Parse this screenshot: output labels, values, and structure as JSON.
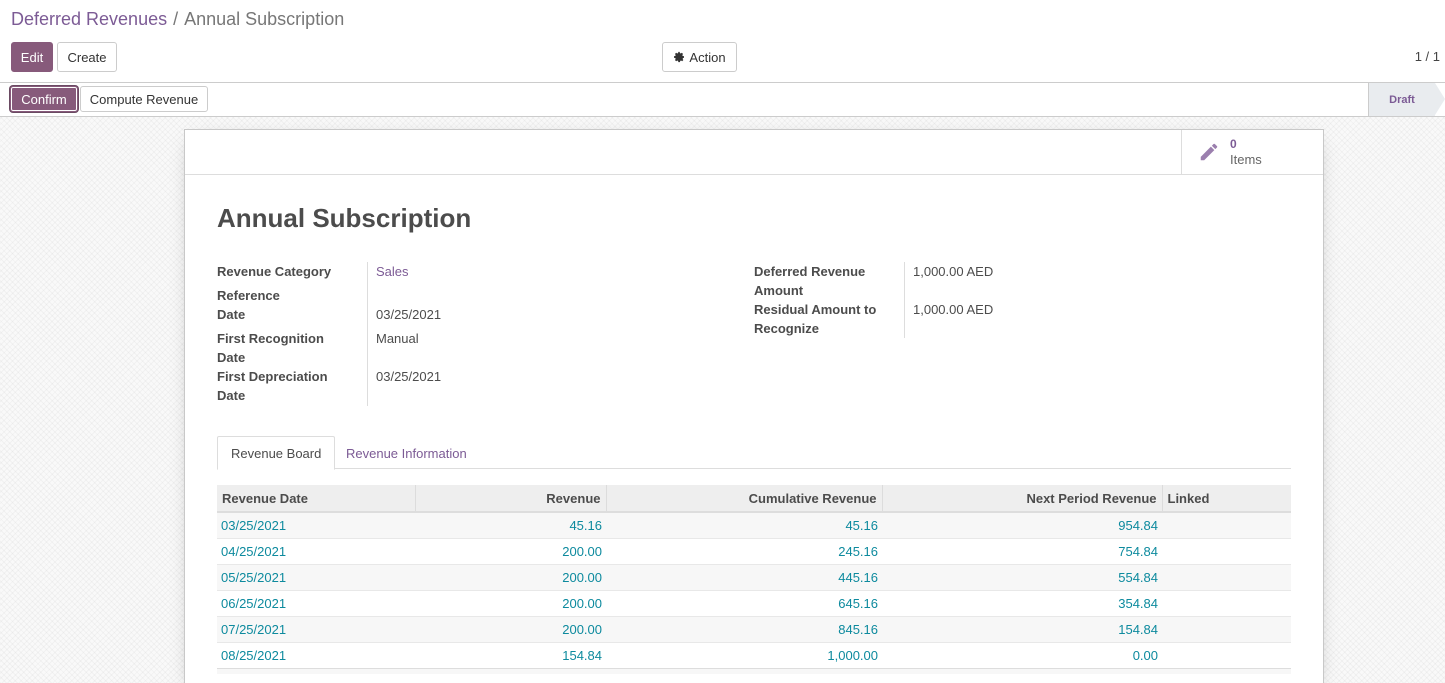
{
  "breadcrumb": {
    "parent": "Deferred Revenues",
    "separator": "/",
    "current": "Annual Subscription"
  },
  "toolbar": {
    "edit_label": "Edit",
    "create_label": "Create",
    "action_label": "Action",
    "pager": "1 / 1"
  },
  "statusbar": {
    "confirm_label": "Confirm",
    "compute_label": "Compute Revenue",
    "status": "Draft"
  },
  "stat_button": {
    "value": "0",
    "label": "Items",
    "icon": "pencil-icon"
  },
  "form": {
    "title": "Annual Subscription",
    "left": {
      "revenue_category_label": "Revenue Category",
      "revenue_category_value": "Sales",
      "reference_label": "Reference",
      "date_label": "Date",
      "date_value": "03/25/2021",
      "first_recognition_label_1": "First Recognition",
      "first_recognition_label_2": "Date",
      "first_recognition_value": "Manual",
      "first_depreciation_label_1": "First Depreciation",
      "first_depreciation_label_2": "Date",
      "first_depreciation_value": "03/25/2021"
    },
    "right": {
      "deferred_label_1": "Deferred Revenue",
      "deferred_label_2": "Amount",
      "deferred_value": "1,000.00 AED",
      "residual_label_1": "Residual Amount to",
      "residual_label_2": "Recognize",
      "residual_value": "1,000.00 AED"
    }
  },
  "tabs": {
    "board": "Revenue Board",
    "info": "Revenue Information"
  },
  "table": {
    "headers": [
      "Revenue Date",
      "Revenue",
      "Cumulative Revenue",
      "Next Period Revenue",
      "Linked"
    ],
    "rows": [
      [
        "03/25/2021",
        "45.16",
        "45.16",
        "954.84",
        ""
      ],
      [
        "04/25/2021",
        "200.00",
        "245.16",
        "754.84",
        ""
      ],
      [
        "05/25/2021",
        "200.00",
        "445.16",
        "554.84",
        ""
      ],
      [
        "06/25/2021",
        "200.00",
        "645.16",
        "354.84",
        ""
      ],
      [
        "07/25/2021",
        "200.00",
        "845.16",
        "154.84",
        ""
      ],
      [
        "08/25/2021",
        "154.84",
        "1,000.00",
        "0.00",
        ""
      ]
    ]
  },
  "colors": {
    "primary": "#875a7b",
    "link": "#7c5b95",
    "table_link": "#0d8a9e"
  }
}
